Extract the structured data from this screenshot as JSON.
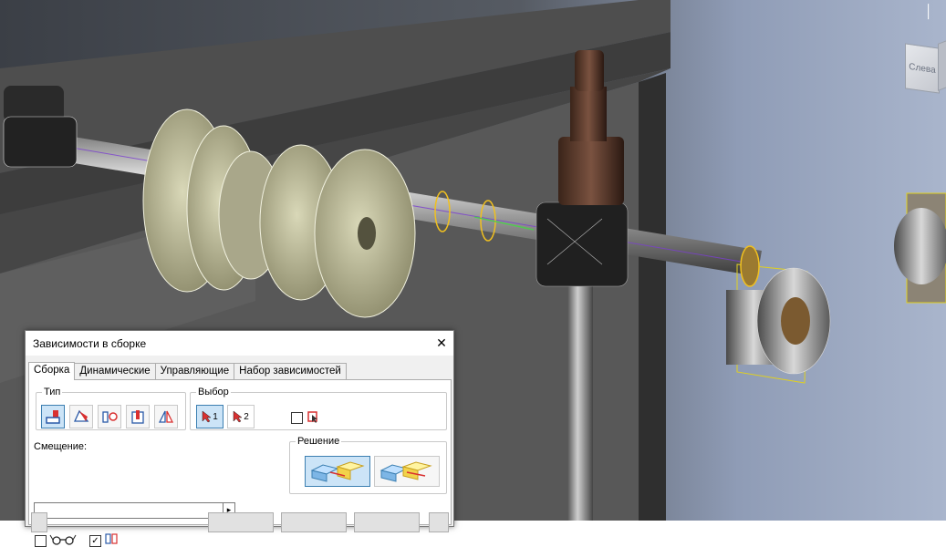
{
  "viewcube": {
    "face_label": "Слева",
    "icon": "view-cube-icon"
  },
  "dialog": {
    "title": "Зависимости в сборке",
    "close_icon": "close-icon",
    "tabs": [
      {
        "label": "Сборка",
        "active": true
      },
      {
        "label": "Динамические",
        "active": false
      },
      {
        "label": "Управляющие",
        "active": false
      },
      {
        "label": "Набор зависимостей",
        "active": false
      }
    ],
    "type_group": {
      "label": "Тип",
      "buttons": [
        {
          "icon": "mate-constraint-icon",
          "pressed": true
        },
        {
          "icon": "angle-constraint-icon",
          "pressed": false
        },
        {
          "icon": "tangent-constraint-icon",
          "pressed": false
        },
        {
          "icon": "insert-constraint-icon",
          "pressed": false
        },
        {
          "icon": "symmetry-constraint-icon",
          "pressed": false
        }
      ]
    },
    "select_group": {
      "label": "Выбор",
      "select1": "1",
      "select2": "2",
      "pick_part_first_checked": false
    },
    "offset": {
      "label": "Смещение:",
      "value": ""
    },
    "solution_group": {
      "label": "Решение"
    },
    "show_preview_checked": false,
    "predict_offset_checked": true,
    "accent": "#3c7fb1"
  }
}
